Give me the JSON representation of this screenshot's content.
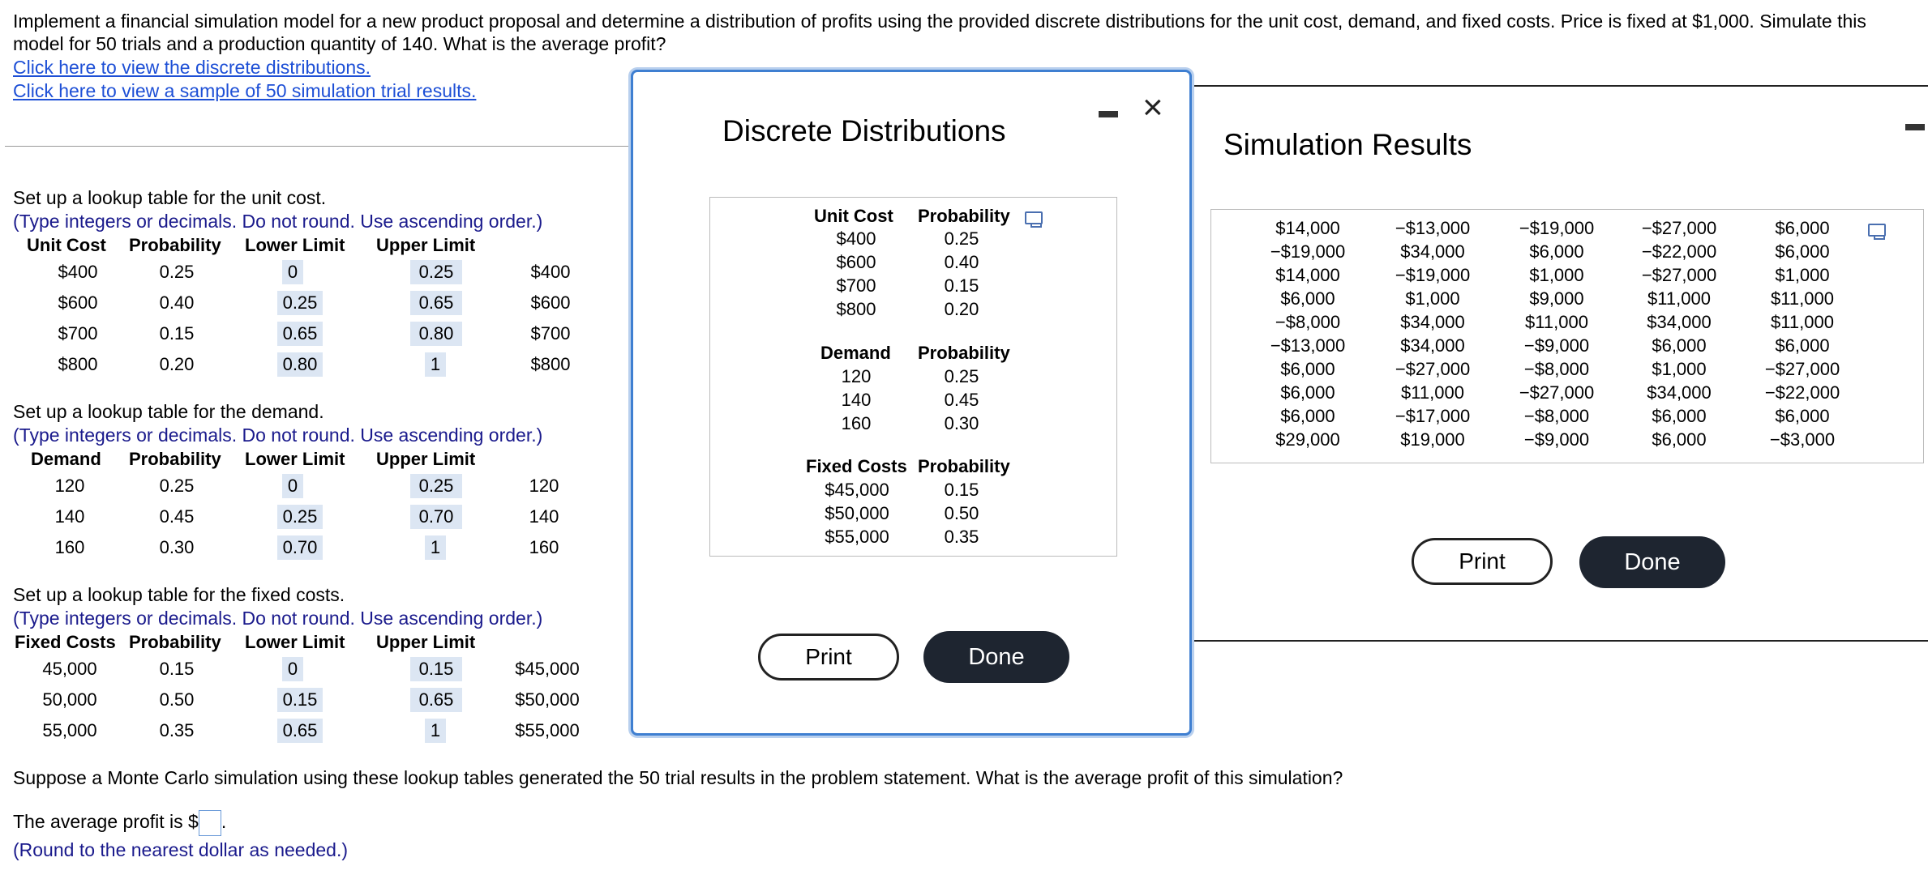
{
  "problem": {
    "line1": "Implement a financial simulation model for a new product proposal and determine a distribution of profits using the provided discrete distributions for the unit cost, demand, and fixed costs. Price is fixed at $1,000. Simulate this",
    "line2": "model for 50 trials and a production quantity of 140. What is the average profit?",
    "link1": "Click here to view the discrete distributions.",
    "link2": "Click here to view a sample of 50 simulation trial results."
  },
  "lookup_unit": {
    "intro": "Set up a lookup table for the unit cost.",
    "hint": "(Type integers or decimals. Do not round. Use ascending order.)",
    "headers": [
      "Unit Cost",
      "Probability",
      "Lower Limit",
      "Upper Limit"
    ],
    "rows": [
      {
        "value": "$400",
        "prob": "0.25",
        "lower": "0",
        "upper": "0.25",
        "result": "$400"
      },
      {
        "value": "$600",
        "prob": "0.40",
        "lower": "0.25",
        "upper": "0.65",
        "result": "$600"
      },
      {
        "value": "$700",
        "prob": "0.15",
        "lower": "0.65",
        "upper": "0.80",
        "result": "$700"
      },
      {
        "value": "$800",
        "prob": "0.20",
        "lower": "0.80",
        "upper": "1",
        "result": "$800"
      }
    ]
  },
  "lookup_demand": {
    "intro": "Set up a lookup table for the demand.",
    "hint": "(Type integers or decimals. Do not round. Use ascending order.)",
    "headers": [
      "Demand",
      "Probability",
      "Lower Limit",
      "Upper Limit"
    ],
    "rows": [
      {
        "value": "120",
        "prob": "0.25",
        "lower": "0",
        "upper": "0.25",
        "result": "120"
      },
      {
        "value": "140",
        "prob": "0.45",
        "lower": "0.25",
        "upper": "0.70",
        "result": "140"
      },
      {
        "value": "160",
        "prob": "0.30",
        "lower": "0.70",
        "upper": "1",
        "result": "160"
      }
    ]
  },
  "lookup_fixed": {
    "intro": "Set up a lookup table for the fixed costs.",
    "hint": "(Type integers or decimals. Do not round. Use ascending order.)",
    "headers": [
      "Fixed Costs",
      "Probability",
      "Lower Limit",
      "Upper Limit"
    ],
    "rows": [
      {
        "value": "45,000",
        "prob": "0.15",
        "lower": "0",
        "upper": "0.15",
        "result": "$45,000"
      },
      {
        "value": "50,000",
        "prob": "0.50",
        "lower": "0.15",
        "upper": "0.65",
        "result": "$50,000"
      },
      {
        "value": "55,000",
        "prob": "0.35",
        "lower": "0.65",
        "upper": "1",
        "result": "$55,000"
      }
    ]
  },
  "question": {
    "text": "Suppose a Monte Carlo simulation using these lookup tables generated the 50 trial results in the problem statement. What is the average profit of this simulation?",
    "answer_prefix": "The average profit is $",
    "answer_suffix": ".",
    "round_hint": "(Round to the nearest dollar as needed.)"
  },
  "dialog_dist": {
    "title": "Discrete Distributions",
    "unit_cost": {
      "h1": "Unit Cost",
      "h2": "Probability",
      "values": [
        "$400",
        "$600",
        "$700",
        "$800"
      ],
      "probs": [
        "0.25",
        "0.40",
        "0.15",
        "0.20"
      ]
    },
    "demand": {
      "h1": "Demand",
      "h2": "Probability",
      "values": [
        "120",
        "140",
        "160"
      ],
      "probs": [
        "0.25",
        "0.45",
        "0.30"
      ]
    },
    "fixed": {
      "h1": "Fixed Costs",
      "h2": "Probability",
      "values": [
        "$45,000",
        "$50,000",
        "$55,000"
      ],
      "probs": [
        "0.15",
        "0.50",
        "0.35"
      ]
    },
    "print_label": "Print",
    "done_label": "Done"
  },
  "dialog_sim": {
    "title": "Simulation Results",
    "columns": [
      [
        "$14,000",
        "−$19,000",
        "$14,000",
        "$6,000",
        "−$8,000",
        "−$13,000",
        "$6,000",
        "$6,000",
        "$6,000",
        "$29,000"
      ],
      [
        "−$13,000",
        "$34,000",
        "−$19,000",
        "$1,000",
        "$34,000",
        "$34,000",
        "−$27,000",
        "$11,000",
        "−$17,000",
        "$19,000"
      ],
      [
        "−$19,000",
        "$6,000",
        "$1,000",
        "$9,000",
        "$11,000",
        "−$9,000",
        "−$8,000",
        "−$27,000",
        "−$8,000",
        "−$9,000"
      ],
      [
        "−$27,000",
        "−$22,000",
        "−$27,000",
        "$11,000",
        "$34,000",
        "$6,000",
        "$1,000",
        "$34,000",
        "$6,000",
        "$6,000"
      ],
      [
        "$6,000",
        "$6,000",
        "$1,000",
        "$11,000",
        "$11,000",
        "$6,000",
        "−$27,000",
        "−$22,000",
        "$6,000",
        "−$3,000"
      ]
    ],
    "print_label": "Print",
    "done_label": "Done"
  }
}
